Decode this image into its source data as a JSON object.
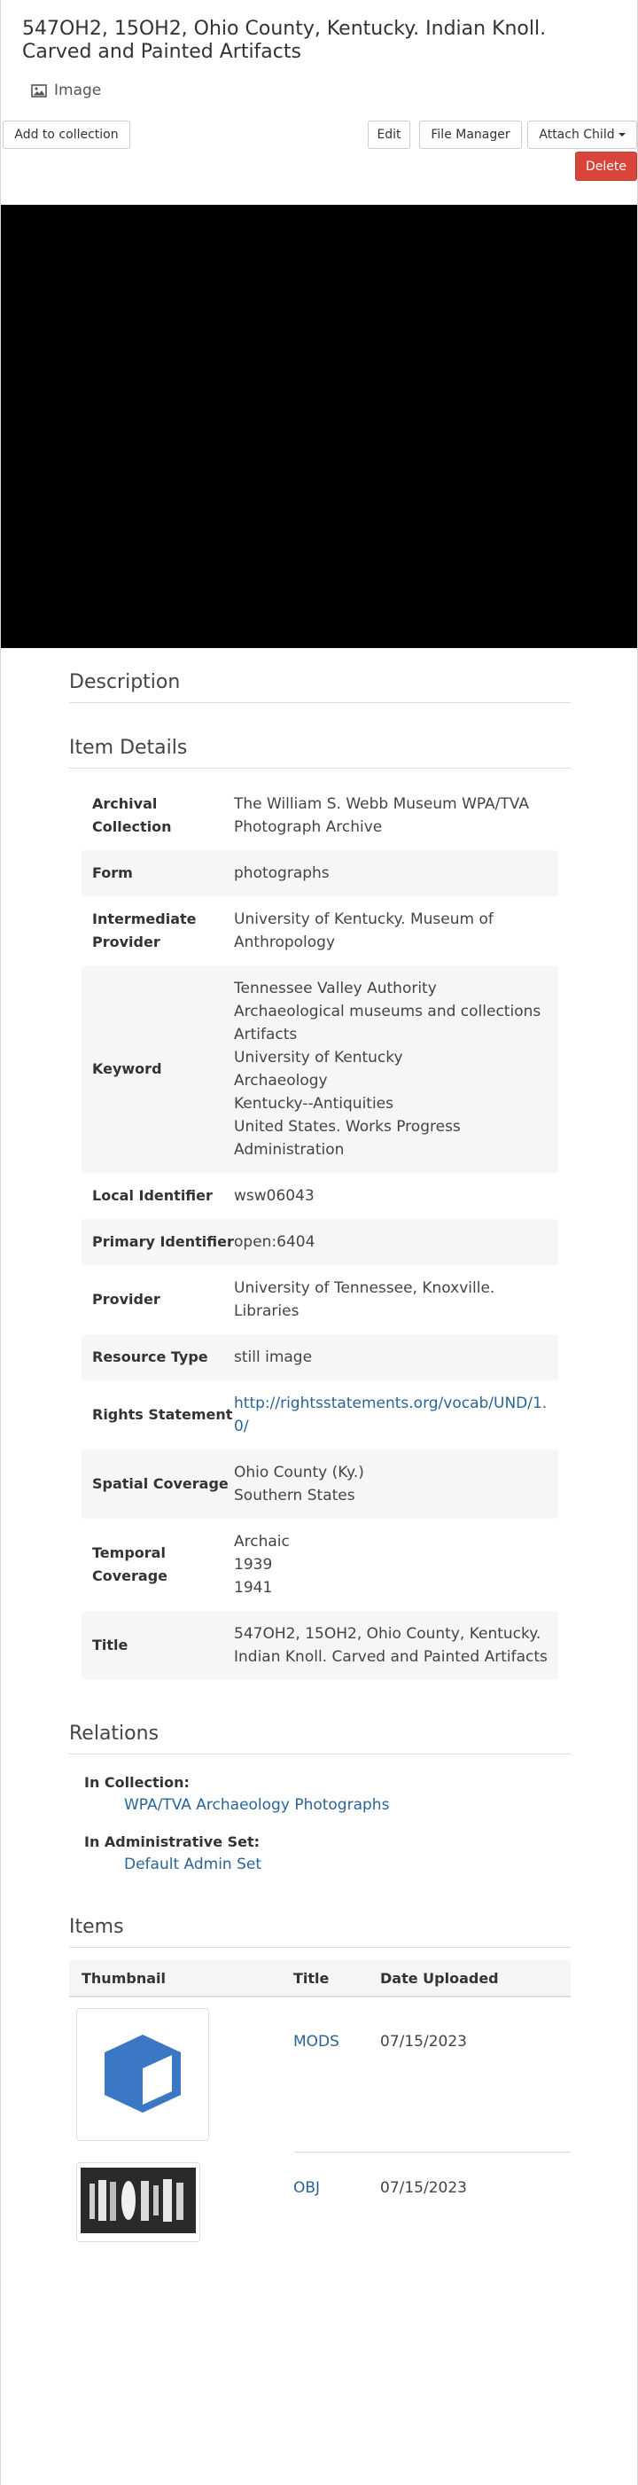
{
  "work": {
    "title": "547OH2, 15OH2, Ohio County, Kentucky. Indian Knoll. Carved and Painted Artifacts",
    "type_label": "Image",
    "type_icon": "picture-icon"
  },
  "toolbar": {
    "add_to_collection": "Add to collection",
    "edit": "Edit",
    "file_manager": "File Manager",
    "attach_child": "Attach Child",
    "delete": "Delete"
  },
  "sections": {
    "description": "Description",
    "item_details": "Item Details",
    "relations": "Relations",
    "items": "Items"
  },
  "details": [
    {
      "label": "Archival Collection",
      "value": "The William S. Webb Museum WPA/TVA Photograph Archive"
    },
    {
      "label": "Form",
      "value": "photographs"
    },
    {
      "label": "Intermediate Provider",
      "value": "University of Kentucky. Museum of Anthropology"
    },
    {
      "label": "Keyword",
      "value": "Tennessee Valley Authority\nArchaeological museums and collections\nArtifacts\nUniversity of Kentucky\nArchaeology\nKentucky--Antiquities\nUnited States. Works Progress Administration"
    },
    {
      "label": "Local Identifier",
      "value": "wsw06043"
    },
    {
      "label": "Primary Identifier",
      "value": "open:6404"
    },
    {
      "label": "Provider",
      "value": "University of Tennessee, Knoxville. Libraries"
    },
    {
      "label": "Resource Type",
      "value": "still image"
    },
    {
      "label": "Rights Statement",
      "value": "http://rightsstatements.org/vocab/UND/1.0/"
    },
    {
      "label": "Spatial Coverage",
      "value": "Ohio County (Ky.)\nSouthern States"
    },
    {
      "label": "Temporal Coverage",
      "value": "Archaic\n1939\n1941"
    },
    {
      "label": "Title",
      "value": "547OH2, 15OH2, Ohio County, Kentucky. Indian Knoll. Carved and Painted Artifacts"
    }
  ],
  "relations": {
    "in_collection_label": "In Collection:",
    "in_collection_value": "WPA/TVA Archaeology Photographs",
    "admin_set_label": "In Administrative Set:",
    "admin_set_value": "Default Admin Set"
  },
  "items_table": {
    "headers": {
      "thumbnail": "Thumbnail",
      "title": "Title",
      "date": "Date Uploaded"
    },
    "rows": [
      {
        "title": "MODS",
        "date": "07/15/2023",
        "thumb_icon": "cube-icon"
      },
      {
        "title": "OBJ",
        "date": "07/15/2023",
        "thumb_icon": "artifacts-photo-icon"
      }
    ]
  },
  "colors": {
    "link": "#2a6496",
    "delete_button": "#d9453a",
    "cube": "#3a78c3",
    "row_alt": "#f6f6f6"
  }
}
